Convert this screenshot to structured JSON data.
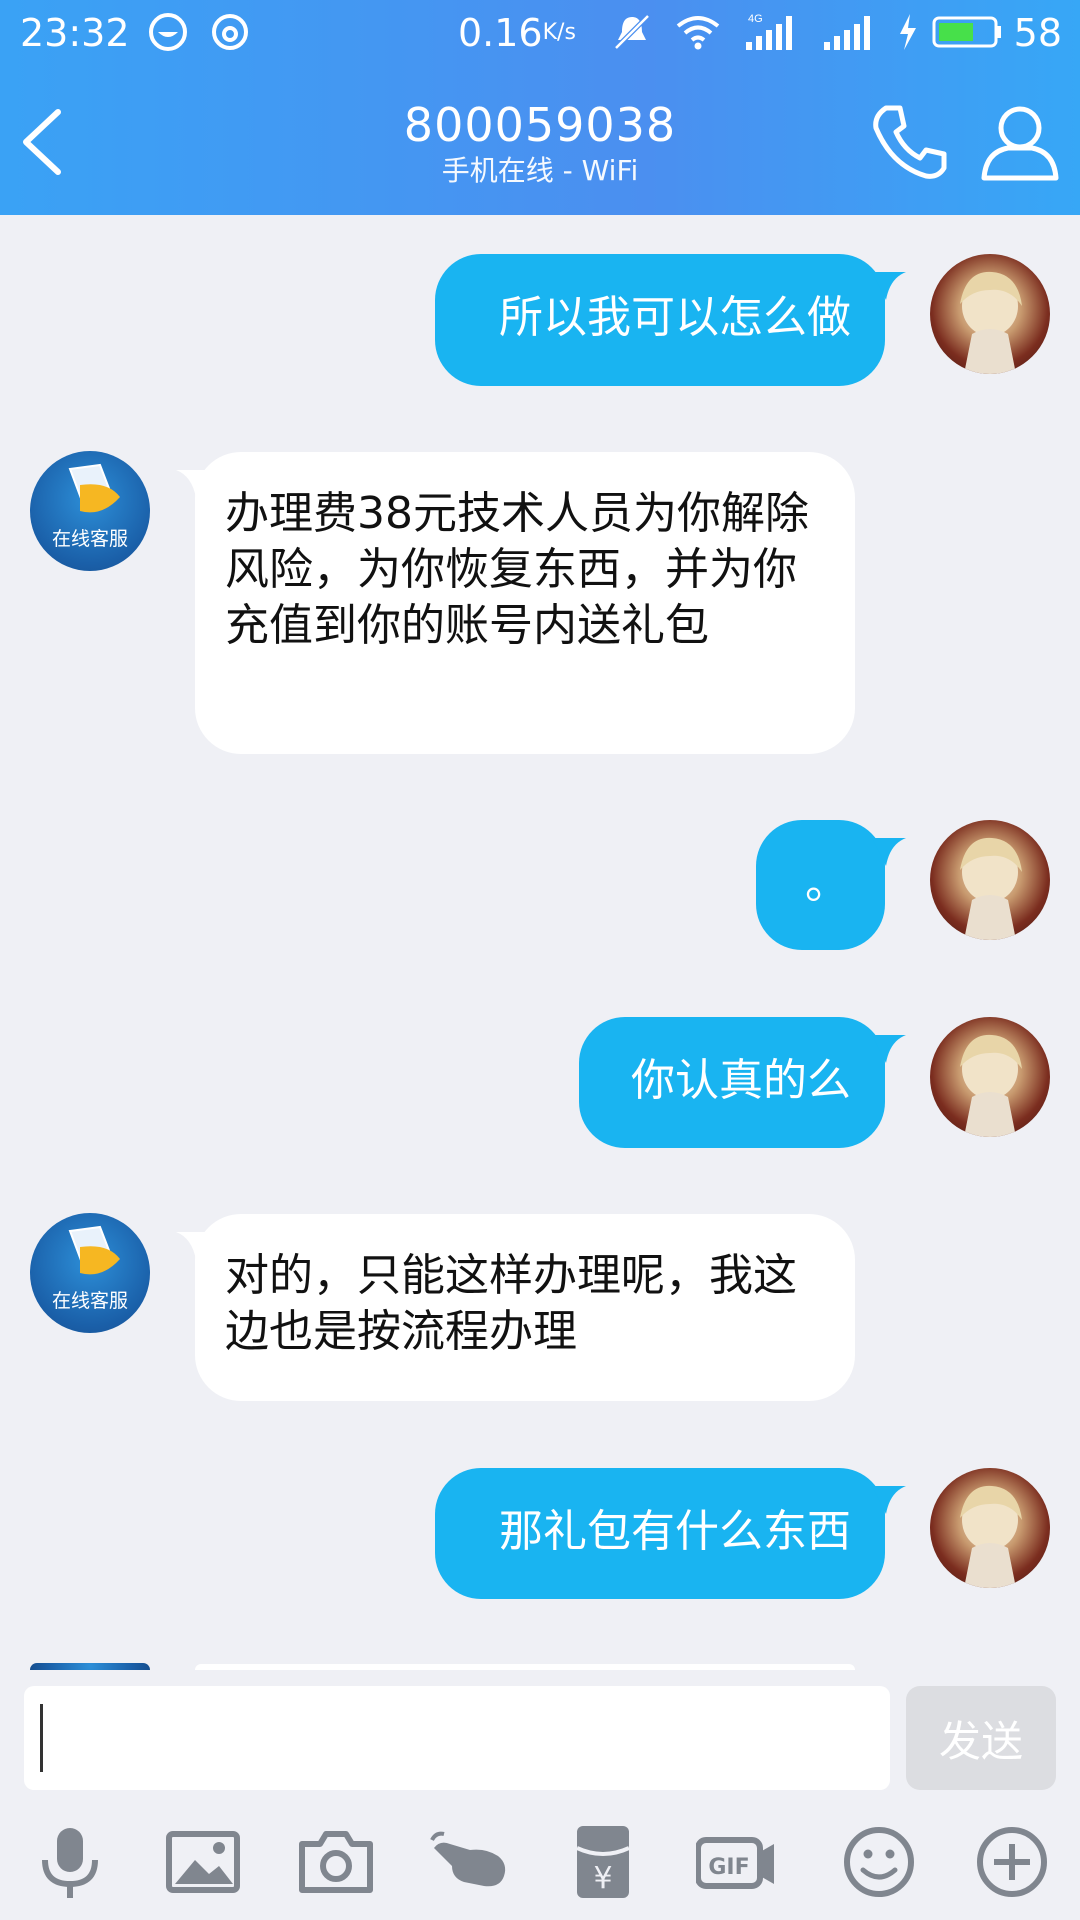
{
  "status_bar": {
    "time": "23:32",
    "speed": "0.16",
    "speed_unit": "K/s",
    "network_type": "4G",
    "battery": "58"
  },
  "header": {
    "title": "800059038",
    "subtitle": "手机在线 - WiFi"
  },
  "messages": [
    {
      "from": "me",
      "text": "所以我可以怎么做"
    },
    {
      "from": "agent",
      "text": "办理费38元技术人员为你解除风险，为你恢复东西，并为你充值到你的账号内送礼包",
      "avatar_label": "在线客服"
    },
    {
      "from": "me",
      "text": "。"
    },
    {
      "from": "me",
      "text": "你认真的么"
    },
    {
      "from": "agent",
      "text": "对的，只能这样办理呢，我这边也是按流程办理",
      "avatar_label": "在线客服"
    },
    {
      "from": "me",
      "text": "那礼包有什么东西"
    }
  ],
  "input": {
    "value": "",
    "send_label": "发送"
  },
  "toolbar": {
    "gif_label": "GIF",
    "yuan_symbol": "¥"
  },
  "colors": {
    "header": "#3aa2f5",
    "outgoing_bubble": "#19b4f1",
    "incoming_bubble": "#ffffff",
    "background": "#eff0f5"
  }
}
